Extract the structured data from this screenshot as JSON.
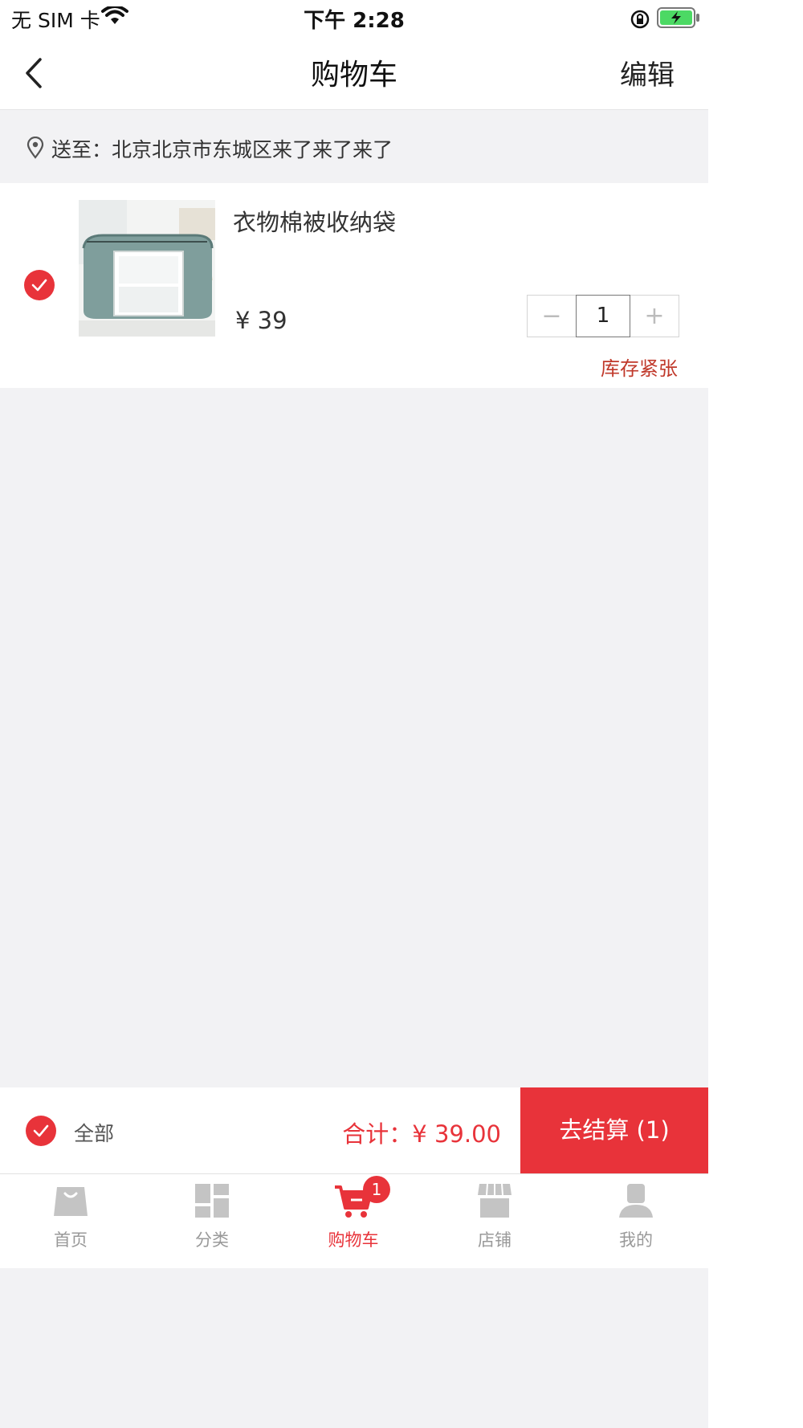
{
  "status_bar": {
    "carrier": "无 SIM 卡",
    "time": "下午 2:28"
  },
  "navbar": {
    "title": "购物车",
    "edit_label": "编辑"
  },
  "address": {
    "text": "送至：北京北京市东城区来了来了来了"
  },
  "cart_items": [
    {
      "name": "衣物棉被收纳袋",
      "price": "¥ 39",
      "quantity": "1",
      "stock_note": "库存紧张",
      "checked": true
    }
  ],
  "stepper": {
    "minus": "−",
    "plus": "+"
  },
  "checkout": {
    "select_all_label": "全部",
    "total_text": "合计：¥ 39.00",
    "pay_label": "去结算 (1)"
  },
  "tabbar": {
    "items": [
      {
        "label": "首页",
        "icon": "home-bag-icon"
      },
      {
        "label": "分类",
        "icon": "category-icon"
      },
      {
        "label": "购物车",
        "icon": "cart-icon",
        "badge": "1"
      },
      {
        "label": "店铺",
        "icon": "store-icon"
      },
      {
        "label": "我的",
        "icon": "profile-icon"
      }
    ]
  },
  "colors": {
    "accent": "#e8333a",
    "background": "#f2f2f4",
    "inactive_tab": "#bbbbbb"
  }
}
